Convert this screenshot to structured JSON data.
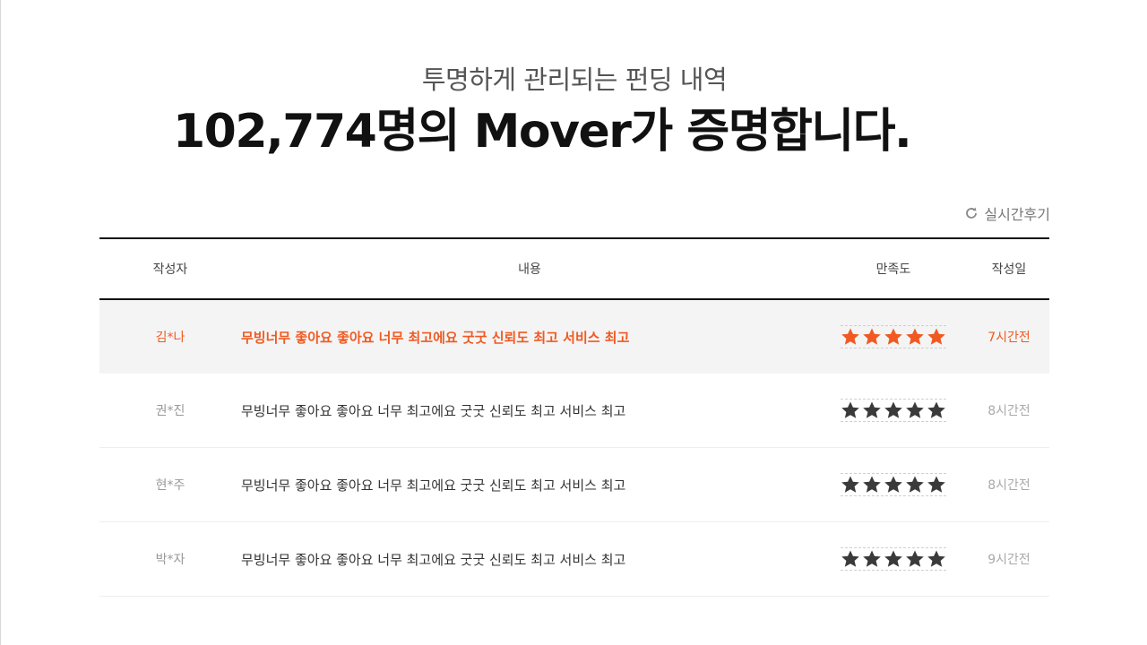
{
  "hero": {
    "subtitle": "투명하게 관리되는 펀딩 내역",
    "title": "102,774명의 Mover가 증명합니다."
  },
  "realtime": {
    "label": "실시간후기",
    "icon": "refresh-icon"
  },
  "colors": {
    "accent": "#f05a22",
    "star_default": "#3a3a3a"
  },
  "table": {
    "headers": {
      "author": "작성자",
      "content": "내용",
      "rating": "만족도",
      "date": "작성일"
    },
    "rows": [
      {
        "author": "김*나",
        "content": "무빙너무 좋아요 좋아요 너무 최고에요 굿굿 신뢰도 최고 서비스 최고",
        "rating": 5,
        "date": "7시간전",
        "highlighted": true
      },
      {
        "author": "권*진",
        "content": "무빙너무 좋아요 좋아요 너무 최고에요 굿굿 신뢰도 최고 서비스 최고",
        "rating": 5,
        "date": "8시간전",
        "highlighted": false
      },
      {
        "author": "현*주",
        "content": "무빙너무 좋아요 좋아요 너무 최고에요 굿굿 신뢰도 최고 서비스 최고",
        "rating": 5,
        "date": "8시간전",
        "highlighted": false
      },
      {
        "author": "박*자",
        "content": "무빙너무 좋아요 좋아요 너무 최고에요 굿굿 신뢰도 최고 서비스 최고",
        "rating": 5,
        "date": "9시간전",
        "highlighted": false
      }
    ]
  }
}
